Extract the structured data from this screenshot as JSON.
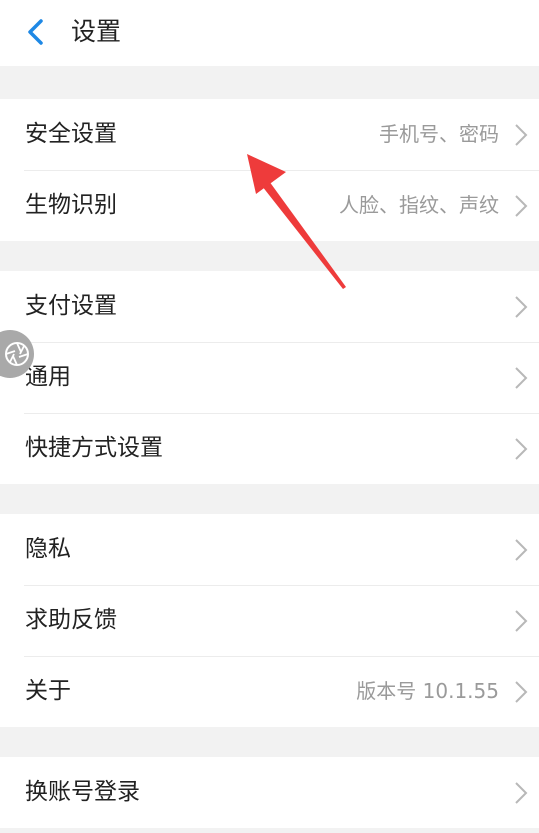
{
  "header": {
    "title": "设置",
    "back_icon": "chevron-left-icon"
  },
  "groups": [
    {
      "items": [
        {
          "label": "安全设置",
          "value": "手机号、密码"
        },
        {
          "label": "生物识别",
          "value": "人脸、指纹、声纹"
        }
      ]
    },
    {
      "items": [
        {
          "label": "支付设置",
          "value": ""
        },
        {
          "label": "通用",
          "value": ""
        },
        {
          "label": "快捷方式设置",
          "value": ""
        }
      ]
    },
    {
      "items": [
        {
          "label": "隐私",
          "value": ""
        },
        {
          "label": "求助反馈",
          "value": ""
        },
        {
          "label": "关于",
          "value": "版本号 10.1.55"
        }
      ]
    },
    {
      "items": [
        {
          "label": "换账号登录",
          "value": ""
        }
      ]
    }
  ],
  "colors": {
    "accent": "#1e88e5",
    "annotation_arrow": "#ee3b3b",
    "secondary_text": "#9a9a9a"
  }
}
